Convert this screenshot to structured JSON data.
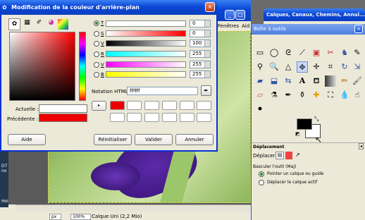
{
  "color_dialog": {
    "title": "Modification de la couleur d'arrière-plan",
    "channels": [
      {
        "label": "T",
        "value": "0"
      },
      {
        "label": "S",
        "value": "0"
      },
      {
        "label": "V",
        "value": "100"
      },
      {
        "label": "R",
        "value": "255"
      },
      {
        "label": "V",
        "value": "255"
      },
      {
        "label": "B",
        "value": "255"
      }
    ],
    "html_label": "Notation HTML :",
    "html_value": "ffffff",
    "current_label": "Actuelle :",
    "previous_label": "Précédente :",
    "buttons": {
      "help": "Aide",
      "reset": "Réinitialiser",
      "ok": "Valider",
      "cancel": "Annuler"
    },
    "history_current": "#ee0000",
    "previous_color": "#ee0000",
    "current_color": "#ffffff"
  },
  "bg_window": {
    "menu_fragment": "Fenêtres",
    "menu_fragment2": "Aid",
    "zoom_value": "100%",
    "status_text": "Calque Uni (2,2 Mio)",
    "unit": "px",
    "left_labels": [
      "D7 no",
      "Hoi"
    ]
  },
  "layers_window": {
    "title": "Calques, Canaux, Chemins, Annul..."
  },
  "toolbox": {
    "title": "Boîte à outils",
    "section_title": "Déplacement",
    "move_label": "Déplacer :",
    "toggle_label": "Basculer l'outil  (Maj)",
    "options": [
      "Pointer un calque ou guide",
      "Déplacer le calque actif"
    ],
    "fg_color": "#000000",
    "bg_color": "#ffffff"
  }
}
